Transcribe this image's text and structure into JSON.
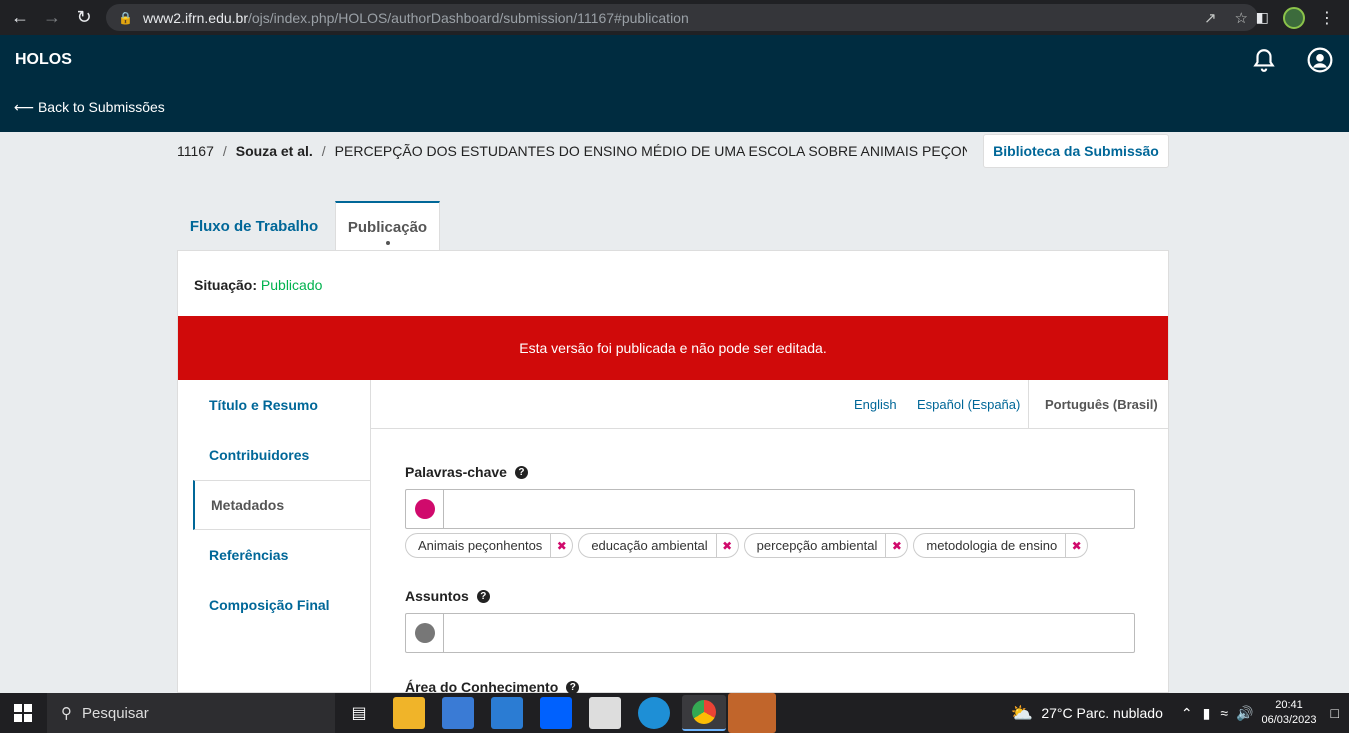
{
  "browser": {
    "url_host": "www2.ifrn.edu.br",
    "url_path": "/ojs/index.php/HOLOS/authorDashboard/submission/11167#publication"
  },
  "header": {
    "title": "HOLOS",
    "back_link": "⟵ Back to Submissões"
  },
  "breadcrumb": {
    "id": "11167",
    "authors": "Souza et al.",
    "title": "PERCEPÇÃO DOS ESTUDANTES DO ENSINO MÉDIO DE UMA ESCOLA SOBRE ANIMAIS PEÇONHENTOS"
  },
  "library_button": "Biblioteca da Submissão",
  "tabs": {
    "workflow": "Fluxo de Trabalho",
    "publication": "Publicação"
  },
  "status": {
    "label": "Situação:",
    "value": "Publicado"
  },
  "alert": "Esta versão foi publicada e não pode ser editada.",
  "sidebar": {
    "items": [
      {
        "label": "Título e Resumo"
      },
      {
        "label": "Contribuidores"
      },
      {
        "label": "Metadados"
      },
      {
        "label": "Referências"
      },
      {
        "label": "Composição Final"
      }
    ]
  },
  "languages": [
    "English",
    "Español (España)",
    "Português (Brasil)"
  ],
  "fields": {
    "keywords_label": "Palavras-chave",
    "keywords": [
      "Animais peçonhentos",
      "educação ambiental",
      "percepção ambiental",
      "metodologia de ensino"
    ],
    "subjects_label": "Assuntos",
    "area_label": "Área do Conhecimento"
  },
  "taskbar": {
    "search_placeholder": "Pesquisar",
    "weather": "27°C  Parc. nublado",
    "time": "20:41",
    "date": "06/03/2023"
  },
  "colors": {
    "header_bg": "#002c40",
    "link": "#006798",
    "alert_bg": "#d00a0a",
    "published": "#00b24e",
    "tag_remove": "#d00a6c"
  }
}
